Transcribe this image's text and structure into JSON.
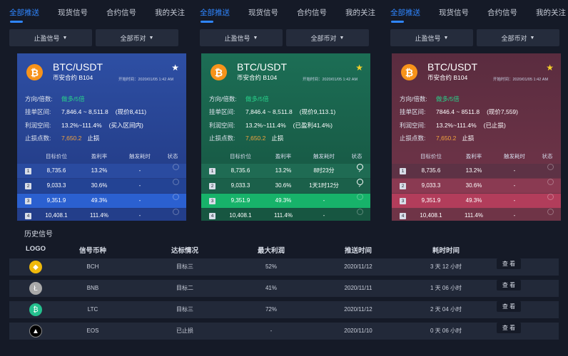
{
  "panels": [
    {
      "tabs": [
        "全部推送",
        "现货信号",
        "合约信号",
        "我的关注"
      ],
      "filters": [
        "止盈信号",
        "全部币对"
      ],
      "card": {
        "theme": "blue",
        "star_color": "#ffffff",
        "coin_symbol": "₿",
        "pair": "BTC/USDT",
        "subtitle": "币安合约 B104",
        "time": "开始时间：2020/01/05  1:42 AM",
        "dir_label": "方向/倍数:",
        "dir_value": "做多/5倍",
        "range_label": "挂单区间:",
        "range_value": "7,846.4 ~ 8,511.8",
        "range_note": "(现价8,411)",
        "profit_label": "利润空间:",
        "profit_value": "13.2%~111.4%",
        "profit_note": "(买入区间内)",
        "stop_label": "止损点数:",
        "stop_value": "7,650.2",
        "stop_note": "止损",
        "headers": [
          "目标价位",
          "盈利率",
          "触发耗时",
          "状态"
        ],
        "rows": [
          {
            "idx": "1",
            "price": "8,735.6",
            "rate": "13.2%",
            "time": "-",
            "done": false
          },
          {
            "idx": "2",
            "price": "9,033.3",
            "rate": "30.6%",
            "time": "-",
            "done": false
          },
          {
            "idx": "3",
            "price": "9,351.9",
            "rate": "49.3%",
            "time": "-",
            "done": false
          },
          {
            "idx": "4",
            "price": "10,408.1",
            "rate": "111.4%",
            "time": "-",
            "done": false
          }
        ]
      }
    },
    {
      "tabs": [
        "全部推送",
        "现货信号",
        "合约信号",
        "我的关注"
      ],
      "filters": [
        "止盈信号",
        "全部币对"
      ],
      "card": {
        "theme": "green",
        "star_color": "#f5d02a",
        "coin_symbol": "₿",
        "pair": "BTC/USDT",
        "subtitle": "币安合约 B104",
        "time": "开始时间：2020/01/05  1:42 AM",
        "dir_label": "方向/倍数:",
        "dir_value": "做多/5倍",
        "range_label": "挂单区间:",
        "range_value": "7,846.4 ~ 8,511.8",
        "range_note": "(现价9,113.1)",
        "profit_label": "利润空间:",
        "profit_value": "13.2%~111.4%",
        "profit_note": "(已盈利41.4%)",
        "stop_label": "止损点数:",
        "stop_value": "7,650.2",
        "stop_note": "止损",
        "headers": [
          "目标价位",
          "盈利率",
          "触发耗时",
          "状态"
        ],
        "rows": [
          {
            "idx": "1",
            "price": "8,735.6",
            "rate": "13.2%",
            "time": "8时23分",
            "done": true
          },
          {
            "idx": "2",
            "price": "9,033.3",
            "rate": "30.6%",
            "time": "1天1时12分",
            "done": true
          },
          {
            "idx": "3",
            "price": "9,351.9",
            "rate": "49.3%",
            "time": "-",
            "done": false
          },
          {
            "idx": "4",
            "price": "10,408.1",
            "rate": "111.4%",
            "time": "-",
            "done": false
          }
        ]
      }
    },
    {
      "tabs": [
        "全部推送",
        "现货信号",
        "合约信号",
        "我的关注"
      ],
      "filters": [
        "止盈信号",
        "全部币对"
      ],
      "card": {
        "theme": "red",
        "star_color": "#f5d02a",
        "coin_symbol": "₿",
        "pair": "BTC/USDT",
        "subtitle": "币安合约 B104",
        "time": "开始时间：2020/01/05  1:42 AM",
        "dir_label": "方向/倍数:",
        "dir_value": "做多/5倍",
        "range_label": "挂单区间:",
        "range_value": "7846.4 ~ 8511.8",
        "range_note": "(现价7,559)",
        "profit_label": "利润空间:",
        "profit_value": "13.2%~111.4%",
        "profit_note": "(已止损)",
        "stop_label": "止损点数:",
        "stop_value": "7,650.2",
        "stop_note": "止损",
        "headers": [
          "目标价位",
          "盈利率",
          "触发耗时",
          "状态"
        ],
        "rows": [
          {
            "idx": "1",
            "price": "8,735.6",
            "rate": "13.2%",
            "time": "-",
            "done": false
          },
          {
            "idx": "2",
            "price": "9,033.3",
            "rate": "30.6%",
            "time": "-",
            "done": false
          },
          {
            "idx": "3",
            "price": "9,351.9",
            "rate": "49.3%",
            "time": "-",
            "done": false
          },
          {
            "idx": "4",
            "price": "10,408.1",
            "rate": "111.4%",
            "time": "-",
            "done": false
          }
        ]
      }
    }
  ],
  "history": {
    "title": "历史信号",
    "headers": [
      "LOGO",
      "信号币种",
      "达标情况",
      "最大利润",
      "推送时间",
      "耗时时间"
    ],
    "rows": [
      {
        "logo": "bch-logo",
        "logo_color": "#f0b90b",
        "coin": "BCH",
        "status": "目标三",
        "profit": "52%",
        "date": "2020/11/12",
        "duration": "3 天 12 小时",
        "action": "查 看"
      },
      {
        "logo": "bnb-logo",
        "logo_color": "#a9a9a9",
        "coin": "BNB",
        "status": "目标二",
        "profit": "41%",
        "date": "2020/11/11",
        "duration": "1 天 06 小时",
        "action": "查 看"
      },
      {
        "logo": "ltc-logo",
        "logo_color": "#24c08e",
        "coin": "LTC",
        "status": "目标三",
        "profit": "72%",
        "date": "2020/11/12",
        "duration": "2 天 04 小时",
        "action": "查 看"
      },
      {
        "logo": "eos-logo",
        "logo_color": "#000000",
        "coin": "EOS",
        "status": "已止损",
        "profit": "-",
        "date": "2020/11/10",
        "duration": "0 天 06 小时",
        "action": "查 看"
      }
    ]
  }
}
